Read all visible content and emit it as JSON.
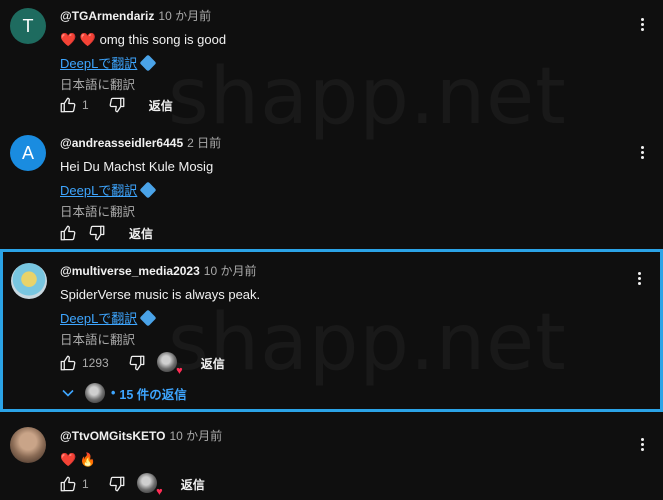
{
  "watermark": "shapp.net",
  "comments": [
    {
      "avatar_letter": "T",
      "avatar_color": "#1e6b5f",
      "handle": "@TGArmendariz",
      "time": "10 か月前",
      "text": "❤️ ❤️ omg this song is good",
      "deepl_label": "DeepLで翻訳",
      "translate_label": "日本語に翻訳",
      "likes": "1",
      "reply_label": "返信"
    },
    {
      "avatar_letter": "A",
      "avatar_color": "#1a8ce0",
      "handle": "@andreasseidler6445",
      "time": "2 日前",
      "text": "Hei  Du  Machst  Kule  Mosig",
      "deepl_label": "DeepLで翻訳",
      "translate_label": "日本語に翻訳",
      "likes": "",
      "reply_label": "返信"
    },
    {
      "handle": "@multiverse_media2023",
      "time": "10 か月前",
      "text": "SpiderVerse music is always peak.",
      "deepl_label": "DeepLで翻訳",
      "translate_label": "日本語に翻訳",
      "likes": "1293",
      "reply_label": "返信",
      "replies_count_label": "15 件の返信",
      "highlight_color": "#2ba3e6"
    },
    {
      "handle": "@TtvOMGitsKETO",
      "time": "10 か月前",
      "text": "❤️ 🔥",
      "likes": "1",
      "reply_label": "返信"
    }
  ]
}
